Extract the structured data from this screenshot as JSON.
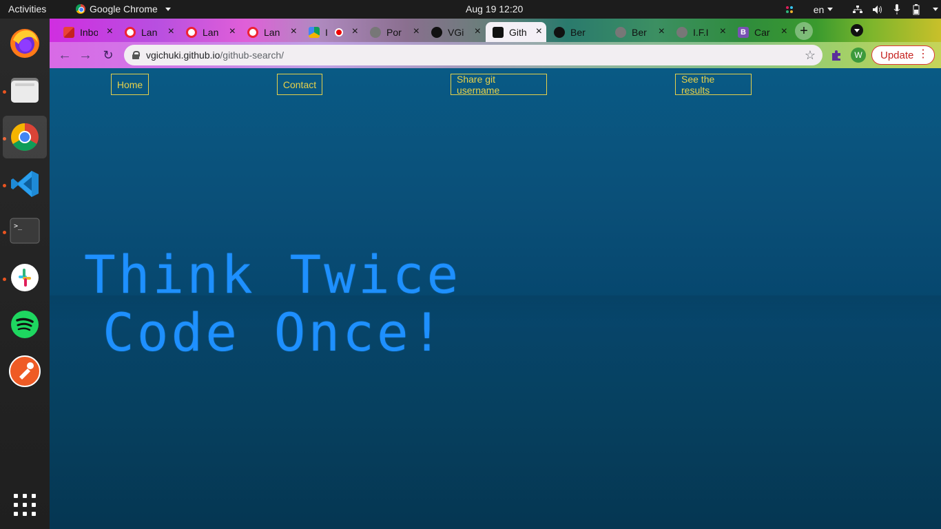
{
  "topbar": {
    "activities": "Activities",
    "app_name": "Google Chrome",
    "clock": "Aug 19  12:20",
    "language": "en"
  },
  "dock": {
    "apps": [
      "Firefox",
      "Files",
      "Google Chrome",
      "Visual Studio Code",
      "Terminal",
      "Slack",
      "Spotify",
      "Postman",
      "Show Applications"
    ]
  },
  "browser": {
    "tabs": [
      {
        "label": "Inbox",
        "favicon": "gmail-icon"
      },
      {
        "label": "Lan",
        "favicon": "lan-icon"
      },
      {
        "label": "Lan",
        "favicon": "lan-icon"
      },
      {
        "label": "Lan",
        "favicon": "lan-icon"
      },
      {
        "label": "I",
        "favicon": "drive-icon"
      },
      {
        "label": "Por",
        "favicon": "globe-icon"
      },
      {
        "label": "VGi",
        "favicon": "github-icon"
      },
      {
        "label": "Gith",
        "favicon": "angular-icon",
        "active": true
      },
      {
        "label": "Ber",
        "favicon": "github-icon"
      },
      {
        "label": "Ber",
        "favicon": "globe-icon"
      },
      {
        "label": "I.F.I",
        "favicon": "globe-icon"
      },
      {
        "label": "Car",
        "favicon": "bootstrap-icon"
      }
    ],
    "url_host": "vgichuki.github.io",
    "url_path": "/github-search/",
    "profile_initial": "W",
    "update_label": "Update"
  },
  "page": {
    "nav": {
      "home": "Home",
      "contact": "Contact",
      "share": "Share git username",
      "results": "See the results"
    },
    "hero_line1": "Think Twice",
    "hero_line2": "Code Once!"
  },
  "colors": {
    "nav_border": "#e8d24a",
    "hero_text": "#1e90ff",
    "page_bg": "#0a4f78"
  }
}
